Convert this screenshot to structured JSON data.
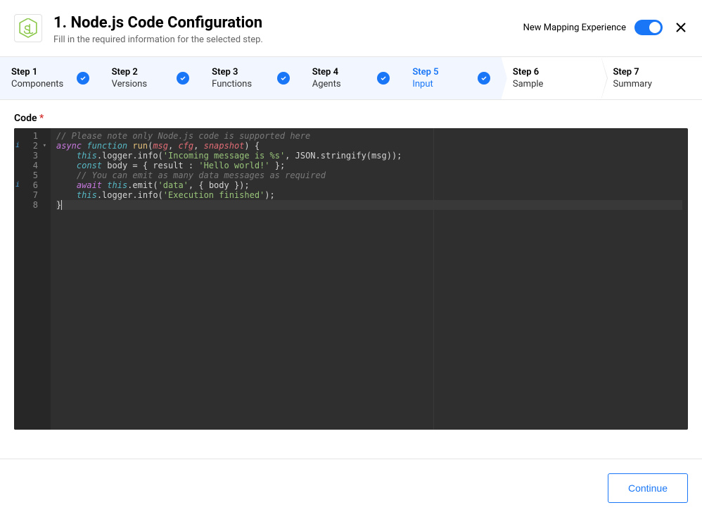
{
  "header": {
    "title": "1. Node.js Code Configuration",
    "subtitle": "Fill in the required information for the selected step.",
    "mapping_toggle_label": "New Mapping Experience"
  },
  "steps": [
    {
      "num": "Step 1",
      "name": "Components",
      "state": "done"
    },
    {
      "num": "Step 2",
      "name": "Versions",
      "state": "done"
    },
    {
      "num": "Step 3",
      "name": "Functions",
      "state": "done"
    },
    {
      "num": "Step 4",
      "name": "Agents",
      "state": "done"
    },
    {
      "num": "Step 5",
      "name": "Input",
      "state": "active"
    },
    {
      "num": "Step 6",
      "name": "Sample",
      "state": "plain"
    },
    {
      "num": "Step 7",
      "name": "Summary",
      "state": "plain"
    }
  ],
  "field": {
    "label": "Code",
    "required": "*"
  },
  "code": {
    "gutter": [
      {
        "n": "1"
      },
      {
        "n": "2",
        "info": true,
        "fold": true
      },
      {
        "n": "3"
      },
      {
        "n": "4"
      },
      {
        "n": "5"
      },
      {
        "n": "6",
        "info": true
      },
      {
        "n": "7"
      },
      {
        "n": "8"
      }
    ],
    "lines": [
      {
        "tokens": [
          [
            "cm",
            "// Please note only Node.js code is supported here"
          ]
        ]
      },
      {
        "tokens": [
          [
            "kw",
            "async"
          ],
          [
            "plain",
            " "
          ],
          [
            "kw2",
            "function"
          ],
          [
            "plain",
            " "
          ],
          [
            "fn",
            "run"
          ],
          [
            "op",
            "("
          ],
          [
            "id",
            "msg"
          ],
          [
            "op",
            ", "
          ],
          [
            "id",
            "cfg"
          ],
          [
            "op",
            ", "
          ],
          [
            "id",
            "snapshot"
          ],
          [
            "op",
            ") {"
          ]
        ]
      },
      {
        "tokens": [
          [
            "plain",
            "    "
          ],
          [
            "kw2",
            "this"
          ],
          [
            "op",
            "."
          ],
          [
            "prop",
            "logger"
          ],
          [
            "op",
            "."
          ],
          [
            "prop",
            "info"
          ],
          [
            "op",
            "("
          ],
          [
            "str",
            "'Incoming message is %s'"
          ],
          [
            "op",
            ", "
          ],
          [
            "prop",
            "JSON"
          ],
          [
            "op",
            "."
          ],
          [
            "prop",
            "stringify"
          ],
          [
            "op",
            "("
          ],
          [
            "prop",
            "msg"
          ],
          [
            "op",
            "));"
          ]
        ]
      },
      {
        "tokens": [
          [
            "plain",
            "    "
          ],
          [
            "kw2",
            "const"
          ],
          [
            "plain",
            " "
          ],
          [
            "prop",
            "body"
          ],
          [
            "op",
            " = { "
          ],
          [
            "prop",
            "result"
          ],
          [
            "op",
            " : "
          ],
          [
            "str",
            "'Hello world!'"
          ],
          [
            "op",
            " };"
          ]
        ]
      },
      {
        "tokens": [
          [
            "plain",
            "    "
          ],
          [
            "cm",
            "// You can emit as many data messages as required"
          ]
        ]
      },
      {
        "tokens": [
          [
            "plain",
            "    "
          ],
          [
            "kw",
            "await"
          ],
          [
            "plain",
            " "
          ],
          [
            "kw2",
            "this"
          ],
          [
            "op",
            "."
          ],
          [
            "prop",
            "emit"
          ],
          [
            "op",
            "("
          ],
          [
            "str",
            "'data'"
          ],
          [
            "op",
            ", { "
          ],
          [
            "prop",
            "body"
          ],
          [
            "op",
            " });"
          ]
        ]
      },
      {
        "tokens": [
          [
            "plain",
            "    "
          ],
          [
            "kw2",
            "this"
          ],
          [
            "op",
            "."
          ],
          [
            "prop",
            "logger"
          ],
          [
            "op",
            "."
          ],
          [
            "prop",
            "info"
          ],
          [
            "op",
            "("
          ],
          [
            "str",
            "'Execution finished'"
          ],
          [
            "op",
            ");"
          ]
        ]
      },
      {
        "tokens": [
          [
            "op",
            "}"
          ]
        ],
        "highlight": true,
        "cursorAfter": true
      }
    ]
  },
  "footer": {
    "continue_label": "Continue"
  }
}
